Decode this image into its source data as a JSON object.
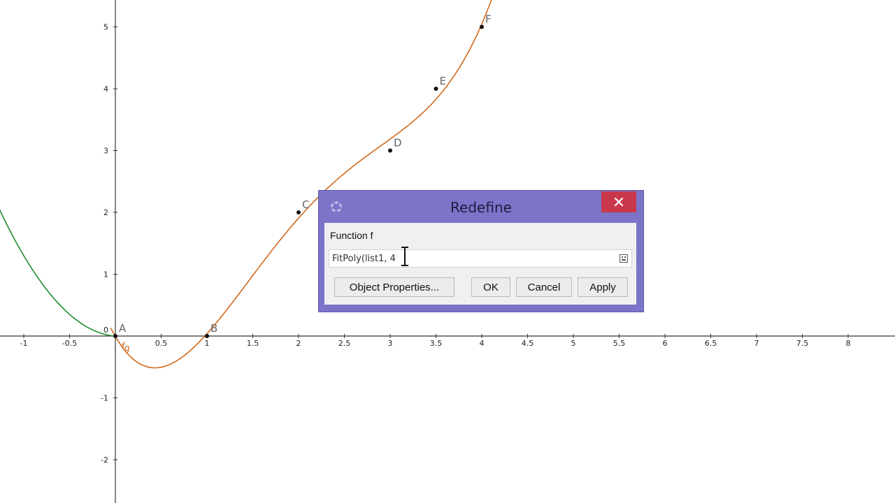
{
  "graph": {
    "x_ticks": [
      "-1",
      "-0.5",
      "0.5",
      "1",
      "1.5",
      "2",
      "2.5",
      "3",
      "3.5",
      "4",
      "4.5",
      "5",
      "5.5",
      "6",
      "6.5",
      "7",
      "7.5",
      "8"
    ],
    "y_ticks": [
      "-2",
      "-1",
      "0",
      "1",
      "2",
      "3",
      "4",
      "5"
    ],
    "points": [
      {
        "label": "A",
        "x": 0,
        "y": 0
      },
      {
        "label": "B",
        "x": 1,
        "y": 0
      },
      {
        "label": "C",
        "x": 2,
        "y": 2
      },
      {
        "label": "D",
        "x": 3,
        "y": 3
      },
      {
        "label": "E",
        "x": 3.5,
        "y": 4
      },
      {
        "label": "F",
        "x": 4,
        "y": 5
      }
    ],
    "curve_labels": {
      "f": "f",
      "g": "g"
    },
    "colors": {
      "f_curve": "#d2691e",
      "g_curve": "#1e8e2e",
      "axes": "#333333",
      "points": "#111111"
    }
  },
  "dialog": {
    "title": "Redefine",
    "label": "Function f",
    "input_value": "FitPoly(list1, 4",
    "buttons": {
      "object_properties": "Object Properties...",
      "ok": "OK",
      "cancel": "Cancel",
      "apply": "Apply"
    },
    "colors": {
      "title_bar": "#7b74c8",
      "close": "#c9384a"
    }
  }
}
